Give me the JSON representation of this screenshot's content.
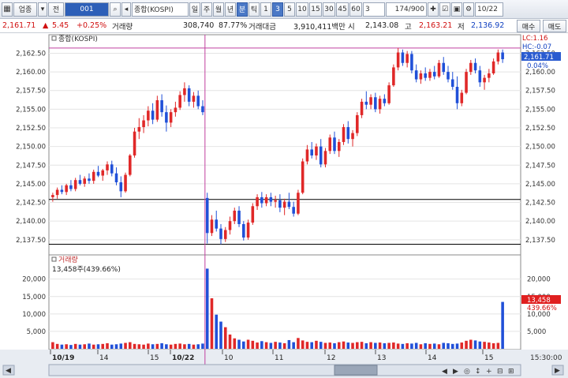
{
  "toolbar": {
    "market": "업종",
    "market_icon": "grid-icon",
    "type": "전",
    "code": "001",
    "search_icon": "search-icon",
    "sound_icon": "speaker-icon",
    "name": "종합(KOSPI)",
    "periods": [
      "일",
      "주",
      "월",
      "년",
      "분",
      "틱"
    ],
    "active_period": "분",
    "intervals": [
      "1",
      "3",
      "5",
      "10",
      "15",
      "30",
      "45",
      "60"
    ],
    "active_interval": "3",
    "interval_value": "3",
    "count": "174/900",
    "tool_icons": [
      "settings-icon",
      "checkbox-icon",
      "lock-icon",
      "gear-icon"
    ],
    "date": "10/22"
  },
  "info": {
    "price": "2,161.71",
    "arrow": "▲",
    "change": "5.45",
    "pct": "+0.25%",
    "volume_label": "거래량",
    "volume": "308,740",
    "volume_ratio": "87.77%",
    "amount_label": "거래대금",
    "amount": "3,910,411백만",
    "open_label": "시",
    "open": "2,143.08",
    "high_label": "고",
    "high": "2,163.21",
    "low_label": "저",
    "low": "2,136.92"
  },
  "side_buttons": {
    "buy": "매수",
    "sell": "매도"
  },
  "price_panel": {
    "legend": "종합(KOSPI)",
    "y_ticks": [
      "2,162.50",
      "2,160.00",
      "2,157.50",
      "2,155.00",
      "2,152.50",
      "2,150.00",
      "2,147.50",
      "2,145.00",
      "2,142.50",
      "2,140.00",
      "2,137.50"
    ],
    "lc_label": "LC:1.16",
    "hc_label": "HC:-0.07",
    "last_label": "2,161.71",
    "last_pct": "0.04%"
  },
  "volume_panel": {
    "legend": "거래량",
    "last_volume_text": "13,458주(439.66%)",
    "y_ticks": [
      "20,000",
      "15,000",
      "10,000",
      "5,000"
    ],
    "last_label": "13,458",
    "last_pct": "439.66%"
  },
  "x_axis": {
    "labels": [
      "10/19",
      "14",
      "15",
      "10/22",
      "10",
      "11",
      "12",
      "13",
      "14",
      "15"
    ],
    "time": "15:30:00"
  },
  "chart_data": {
    "type": "candlestick",
    "y_range": [
      2136.0,
      2163.5
    ],
    "volume_range": [
      0,
      24000
    ],
    "hlines": [
      2163.2,
      2142.9,
      2136.9
    ],
    "session_break_index": 50,
    "candles": [
      [
        2143.2,
        2143.8,
        2142.6,
        2143.5
      ],
      [
        2143.5,
        2144.5,
        2143.0,
        2144.2
      ],
      [
        2144.2,
        2144.8,
        2143.6,
        2143.9
      ],
      [
        2143.9,
        2145.0,
        2143.5,
        2144.8
      ],
      [
        2144.8,
        2145.5,
        2144.0,
        2144.3
      ],
      [
        2144.3,
        2145.8,
        2144.0,
        2145.5
      ],
      [
        2145.5,
        2146.2,
        2144.8,
        2145.0
      ],
      [
        2145.0,
        2146.0,
        2144.6,
        2145.7
      ],
      [
        2145.7,
        2146.4,
        2145.0,
        2145.4
      ],
      [
        2145.4,
        2146.9,
        2145.0,
        2146.6
      ],
      [
        2146.6,
        2147.4,
        2145.9,
        2146.1
      ],
      [
        2146.1,
        2147.0,
        2145.4,
        2146.8
      ],
      [
        2146.8,
        2148.0,
        2146.2,
        2147.6
      ],
      [
        2147.6,
        2148.1,
        2146.0,
        2146.4
      ],
      [
        2146.4,
        2147.2,
        2144.8,
        2145.2
      ],
      [
        2145.2,
        2146.0,
        2143.2,
        2144.0
      ],
      [
        2144.0,
        2146.5,
        2143.8,
        2146.2
      ],
      [
        2146.2,
        2149.0,
        2146.0,
        2148.8
      ],
      [
        2148.8,
        2152.5,
        2148.5,
        2152.0
      ],
      [
        2152.0,
        2153.8,
        2151.0,
        2152.6
      ],
      [
        2152.6,
        2154.2,
        2151.8,
        2153.5
      ],
      [
        2153.5,
        2155.4,
        2152.7,
        2154.8
      ],
      [
        2154.8,
        2155.8,
        2153.0,
        2153.6
      ],
      [
        2153.6,
        2156.8,
        2153.3,
        2156.2
      ],
      [
        2156.2,
        2157.0,
        2154.0,
        2154.6
      ],
      [
        2154.6,
        2155.5,
        2152.0,
        2153.2
      ],
      [
        2153.2,
        2155.0,
        2152.6,
        2154.6
      ],
      [
        2154.6,
        2156.0,
        2154.0,
        2155.2
      ],
      [
        2155.2,
        2157.4,
        2154.9,
        2156.9
      ],
      [
        2156.9,
        2158.6,
        2156.0,
        2157.8
      ],
      [
        2157.8,
        2158.2,
        2155.4,
        2156.0
      ],
      [
        2156.0,
        2157.3,
        2155.2,
        2156.8
      ],
      [
        2156.8,
        2157.5,
        2155.0,
        2155.4
      ],
      [
        2155.4,
        2156.2,
        2154.2,
        2154.6
      ],
      [
        2143.1,
        2143.8,
        2137.0,
        2138.4
      ],
      [
        2138.4,
        2140.8,
        2138.0,
        2140.2
      ],
      [
        2140.2,
        2141.4,
        2138.6,
        2139.0
      ],
      [
        2139.0,
        2139.6,
        2136.9,
        2137.6
      ],
      [
        2137.6,
        2139.2,
        2137.2,
        2138.8
      ],
      [
        2138.8,
        2140.6,
        2138.2,
        2140.0
      ],
      [
        2140.0,
        2141.8,
        2139.6,
        2141.4
      ],
      [
        2141.4,
        2142.0,
        2139.2,
        2139.6
      ],
      [
        2139.6,
        2140.0,
        2137.4,
        2137.8
      ],
      [
        2137.8,
        2140.2,
        2137.5,
        2139.8
      ],
      [
        2139.8,
        2142.4,
        2139.5,
        2142.0
      ],
      [
        2142.0,
        2143.6,
        2141.5,
        2143.2
      ],
      [
        2143.2,
        2143.9,
        2141.8,
        2142.4
      ],
      [
        2142.4,
        2143.6,
        2142.0,
        2143.2
      ],
      [
        2143.2,
        2143.8,
        2142.0,
        2142.6
      ],
      [
        2142.6,
        2143.4,
        2141.8,
        2142.8
      ],
      [
        2142.8,
        2143.6,
        2141.2,
        2141.8
      ],
      [
        2141.8,
        2143.0,
        2140.8,
        2142.6
      ],
      [
        2142.6,
        2143.8,
        2141.6,
        2141.9
      ],
      [
        2141.9,
        2142.6,
        2140.6,
        2141.0
      ],
      [
        2141.0,
        2144.2,
        2140.8,
        2143.8
      ],
      [
        2143.8,
        2148.4,
        2143.6,
        2148.0
      ],
      [
        2148.0,
        2150.2,
        2147.6,
        2149.6
      ],
      [
        2149.6,
        2150.6,
        2148.4,
        2148.8
      ],
      [
        2148.8,
        2150.4,
        2148.2,
        2150.0
      ],
      [
        2150.0,
        2151.0,
        2147.2,
        2147.6
      ],
      [
        2147.6,
        2149.8,
        2147.2,
        2149.4
      ],
      [
        2149.4,
        2151.6,
        2149.0,
        2151.2
      ],
      [
        2151.2,
        2152.0,
        2149.0,
        2149.4
      ],
      [
        2149.4,
        2151.0,
        2148.6,
        2150.6
      ],
      [
        2150.6,
        2153.0,
        2150.2,
        2152.6
      ],
      [
        2152.6,
        2153.4,
        2150.4,
        2151.0
      ],
      [
        2151.0,
        2152.2,
        2150.0,
        2151.8
      ],
      [
        2151.8,
        2154.6,
        2151.4,
        2154.2
      ],
      [
        2154.2,
        2156.4,
        2153.8,
        2156.0
      ],
      [
        2156.0,
        2157.4,
        2155.0,
        2155.6
      ],
      [
        2155.6,
        2157.0,
        2155.0,
        2156.6
      ],
      [
        2156.6,
        2157.2,
        2154.6,
        2155.0
      ],
      [
        2155.0,
        2156.8,
        2154.4,
        2156.4
      ],
      [
        2156.4,
        2157.0,
        2155.4,
        2155.8
      ],
      [
        2155.8,
        2158.6,
        2155.6,
        2158.2
      ],
      [
        2158.2,
        2161.0,
        2158.0,
        2160.6
      ],
      [
        2160.6,
        2163.2,
        2160.2,
        2162.6
      ],
      [
        2162.6,
        2163.0,
        2160.8,
        2161.2
      ],
      [
        2161.2,
        2162.8,
        2160.6,
        2162.4
      ],
      [
        2162.4,
        2162.8,
        2159.8,
        2160.2
      ],
      [
        2160.2,
        2161.0,
        2158.6,
        2159.0
      ],
      [
        2159.0,
        2160.2,
        2158.4,
        2159.8
      ],
      [
        2159.8,
        2160.6,
        2158.8,
        2159.2
      ],
      [
        2159.2,
        2160.4,
        2158.8,
        2160.0
      ],
      [
        2160.0,
        2160.8,
        2159.0,
        2159.4
      ],
      [
        2159.4,
        2161.6,
        2159.2,
        2161.2
      ],
      [
        2161.2,
        2162.0,
        2159.6,
        2160.0
      ],
      [
        2160.0,
        2160.8,
        2158.6,
        2159.0
      ],
      [
        2159.0,
        2160.0,
        2157.6,
        2158.0
      ],
      [
        2158.0,
        2159.4,
        2155.0,
        2155.8
      ],
      [
        2155.8,
        2157.6,
        2155.4,
        2157.2
      ],
      [
        2157.2,
        2160.4,
        2157.0,
        2160.0
      ],
      [
        2160.0,
        2161.6,
        2159.6,
        2161.2
      ],
      [
        2161.2,
        2161.8,
        2159.8,
        2160.2
      ],
      [
        2160.2,
        2160.8,
        2158.0,
        2158.6
      ],
      [
        2158.6,
        2159.6,
        2157.6,
        2159.2
      ],
      [
        2159.2,
        2160.4,
        2158.6,
        2159.8
      ],
      [
        2159.8,
        2161.8,
        2159.6,
        2161.4
      ],
      [
        2161.4,
        2163.0,
        2161.0,
        2162.6
      ],
      [
        2162.6,
        2163.0,
        2161.2,
        2161.7
      ]
    ],
    "volumes": [
      1900,
      1400,
      1200,
      1300,
      1100,
      1400,
      1200,
      1300,
      1500,
      1200,
      1300,
      1400,
      1600,
      1200,
      1300,
      1500,
      1700,
      1900,
      1400,
      1300,
      1200,
      1500,
      1300,
      1400,
      1600,
      1300,
      1200,
      1400,
      1500,
      1300,
      1400,
      1200,
      1300,
      1500,
      23000,
      14500,
      9800,
      7800,
      6200,
      4100,
      3000,
      2600,
      2100,
      2600,
      2300,
      1800,
      2200,
      1900,
      1700,
      2000,
      1800,
      1600,
      2500,
      1900,
      3100,
      2400,
      2000,
      1900,
      2300,
      2000,
      1700,
      1800,
      1600,
      1900,
      2100,
      1800,
      1700,
      1900,
      2000,
      1600,
      1900,
      1700,
      1800,
      1600,
      1700,
      1800,
      1500,
      1400,
      1600,
      1500,
      1700,
      1300,
      1600,
      1400,
      1500,
      1300,
      1700,
      1600,
      1400,
      1500,
      1800,
      2300,
      2600,
      2400,
      2100,
      2000,
      1800,
      1600,
      1700,
      13458
    ]
  }
}
